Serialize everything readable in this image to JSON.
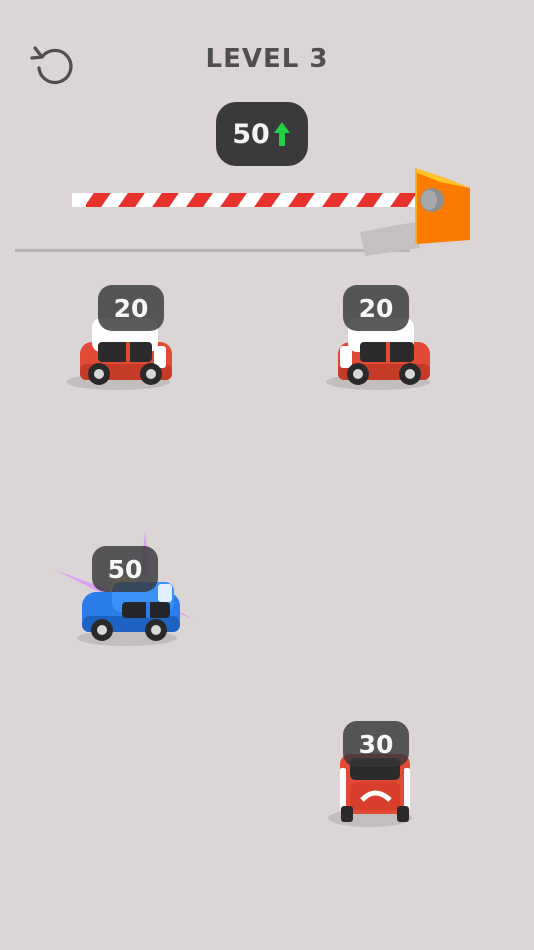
{
  "hud": {
    "level_label": "LEVEL 3",
    "target_value": "50",
    "restart_icon": "restart-icon",
    "up_arrow_icon": "up-arrow-icon",
    "up_arrow_color": "#23d144"
  },
  "cars": [
    {
      "value": "20",
      "color": "#e14b35",
      "kind": "red-mini"
    },
    {
      "value": "20",
      "color": "#e14b35",
      "kind": "red-mini"
    },
    {
      "value": "50",
      "color": "#2b7de9",
      "kind": "blue-coupe"
    },
    {
      "value": "30",
      "color": "#e14b35",
      "kind": "red-mini"
    }
  ],
  "colors": {
    "background": "#dcd5d6",
    "badge": "#3a3a3c",
    "barrier_stripe": "#e7322e",
    "barrier_post": "#fb7c00"
  }
}
